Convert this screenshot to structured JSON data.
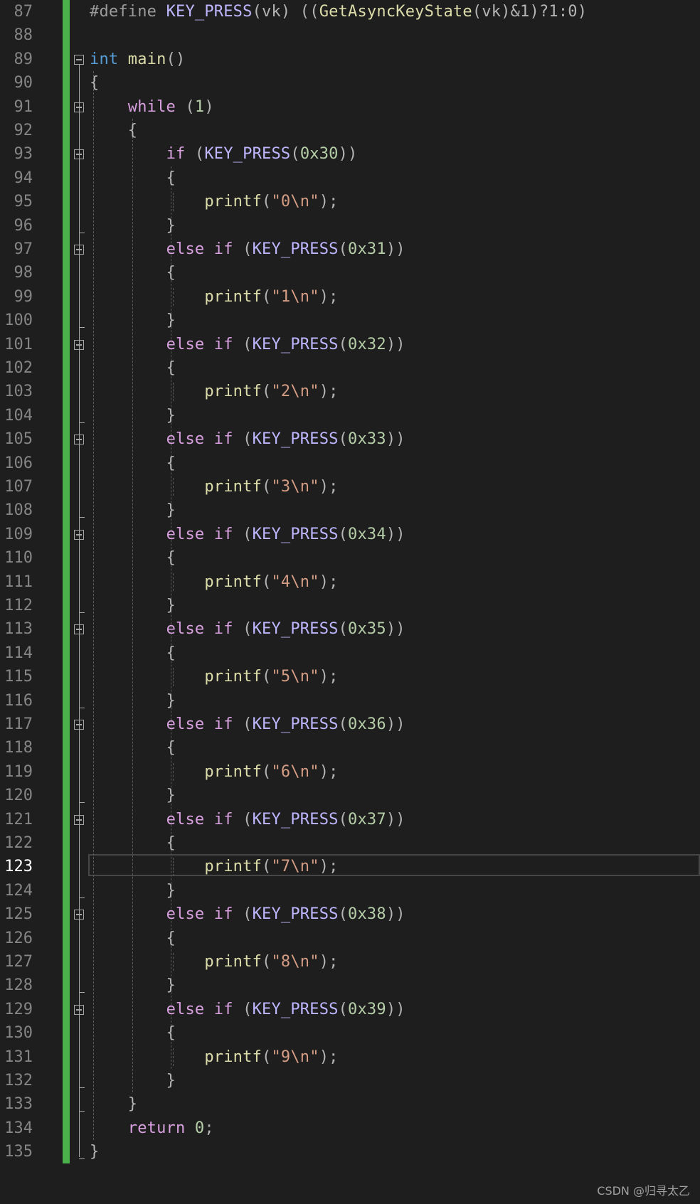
{
  "editor": {
    "current_line_number": "123",
    "lines": [
      {
        "n": "87",
        "tokens": [
          {
            "t": "#define ",
            "c": "pp"
          },
          {
            "t": "KEY_PRESS",
            "c": "mac"
          },
          {
            "t": "(vk) ((",
            "c": "punc"
          },
          {
            "t": "GetAsyncKeyState",
            "c": "fn"
          },
          {
            "t": "(vk)&1)?1:0)",
            "c": "punc"
          }
        ]
      },
      {
        "n": "88",
        "tokens": []
      },
      {
        "n": "89",
        "tokens": [
          {
            "t": "int ",
            "c": "kw"
          },
          {
            "t": "main",
            "c": "fn"
          },
          {
            "t": "()",
            "c": "punc"
          }
        ]
      },
      {
        "n": "90",
        "tokens": [
          {
            "t": "{",
            "c": "punc"
          }
        ]
      },
      {
        "n": "91",
        "tokens": [
          {
            "t": "    "
          },
          {
            "t": "while",
            "c": "ctl"
          },
          {
            "t": " (",
            "c": "punc"
          },
          {
            "t": "1",
            "c": "num"
          },
          {
            "t": ")",
            "c": "punc"
          }
        ]
      },
      {
        "n": "92",
        "tokens": [
          {
            "t": "    {",
            "c": "punc"
          }
        ]
      },
      {
        "n": "93",
        "tokens": [
          {
            "t": "        "
          },
          {
            "t": "if",
            "c": "ctl"
          },
          {
            "t": " (",
            "c": "punc"
          },
          {
            "t": "KEY_PRESS",
            "c": "mac"
          },
          {
            "t": "(",
            "c": "punc"
          },
          {
            "t": "0x30",
            "c": "num"
          },
          {
            "t": "))",
            "c": "punc"
          }
        ]
      },
      {
        "n": "94",
        "tokens": [
          {
            "t": "        {",
            "c": "punc"
          }
        ]
      },
      {
        "n": "95",
        "tokens": [
          {
            "t": "            "
          },
          {
            "t": "printf",
            "c": "fn"
          },
          {
            "t": "(",
            "c": "punc"
          },
          {
            "t": "\"0\\n\"",
            "c": "str"
          },
          {
            "t": ");",
            "c": "punc"
          }
        ]
      },
      {
        "n": "96",
        "tokens": [
          {
            "t": "        }",
            "c": "punc"
          }
        ]
      },
      {
        "n": "97",
        "tokens": [
          {
            "t": "        "
          },
          {
            "t": "else if",
            "c": "ctl"
          },
          {
            "t": " (",
            "c": "punc"
          },
          {
            "t": "KEY_PRESS",
            "c": "mac"
          },
          {
            "t": "(",
            "c": "punc"
          },
          {
            "t": "0x31",
            "c": "num"
          },
          {
            "t": "))",
            "c": "punc"
          }
        ]
      },
      {
        "n": "98",
        "tokens": [
          {
            "t": "        {",
            "c": "punc"
          }
        ]
      },
      {
        "n": "99",
        "tokens": [
          {
            "t": "            "
          },
          {
            "t": "printf",
            "c": "fn"
          },
          {
            "t": "(",
            "c": "punc"
          },
          {
            "t": "\"1\\n\"",
            "c": "str"
          },
          {
            "t": ");",
            "c": "punc"
          }
        ]
      },
      {
        "n": "100",
        "tokens": [
          {
            "t": "        }",
            "c": "punc"
          }
        ]
      },
      {
        "n": "101",
        "tokens": [
          {
            "t": "        "
          },
          {
            "t": "else if",
            "c": "ctl"
          },
          {
            "t": " (",
            "c": "punc"
          },
          {
            "t": "KEY_PRESS",
            "c": "mac"
          },
          {
            "t": "(",
            "c": "punc"
          },
          {
            "t": "0x32",
            "c": "num"
          },
          {
            "t": "))",
            "c": "punc"
          }
        ]
      },
      {
        "n": "102",
        "tokens": [
          {
            "t": "        {",
            "c": "punc"
          }
        ]
      },
      {
        "n": "103",
        "tokens": [
          {
            "t": "            "
          },
          {
            "t": "printf",
            "c": "fn"
          },
          {
            "t": "(",
            "c": "punc"
          },
          {
            "t": "\"2\\n\"",
            "c": "str"
          },
          {
            "t": ");",
            "c": "punc"
          }
        ]
      },
      {
        "n": "104",
        "tokens": [
          {
            "t": "        }",
            "c": "punc"
          }
        ]
      },
      {
        "n": "105",
        "tokens": [
          {
            "t": "        "
          },
          {
            "t": "else if",
            "c": "ctl"
          },
          {
            "t": " (",
            "c": "punc"
          },
          {
            "t": "KEY_PRESS",
            "c": "mac"
          },
          {
            "t": "(",
            "c": "punc"
          },
          {
            "t": "0x33",
            "c": "num"
          },
          {
            "t": "))",
            "c": "punc"
          }
        ]
      },
      {
        "n": "106",
        "tokens": [
          {
            "t": "        {",
            "c": "punc"
          }
        ]
      },
      {
        "n": "107",
        "tokens": [
          {
            "t": "            "
          },
          {
            "t": "printf",
            "c": "fn"
          },
          {
            "t": "(",
            "c": "punc"
          },
          {
            "t": "\"3\\n\"",
            "c": "str"
          },
          {
            "t": ");",
            "c": "punc"
          }
        ]
      },
      {
        "n": "108",
        "tokens": [
          {
            "t": "        }",
            "c": "punc"
          }
        ]
      },
      {
        "n": "109",
        "tokens": [
          {
            "t": "        "
          },
          {
            "t": "else if",
            "c": "ctl"
          },
          {
            "t": " (",
            "c": "punc"
          },
          {
            "t": "KEY_PRESS",
            "c": "mac"
          },
          {
            "t": "(",
            "c": "punc"
          },
          {
            "t": "0x34",
            "c": "num"
          },
          {
            "t": "))",
            "c": "punc"
          }
        ]
      },
      {
        "n": "110",
        "tokens": [
          {
            "t": "        {",
            "c": "punc"
          }
        ]
      },
      {
        "n": "111",
        "tokens": [
          {
            "t": "            "
          },
          {
            "t": "printf",
            "c": "fn"
          },
          {
            "t": "(",
            "c": "punc"
          },
          {
            "t": "\"4\\n\"",
            "c": "str"
          },
          {
            "t": ");",
            "c": "punc"
          }
        ]
      },
      {
        "n": "112",
        "tokens": [
          {
            "t": "        }",
            "c": "punc"
          }
        ]
      },
      {
        "n": "113",
        "tokens": [
          {
            "t": "        "
          },
          {
            "t": "else if",
            "c": "ctl"
          },
          {
            "t": " (",
            "c": "punc"
          },
          {
            "t": "KEY_PRESS",
            "c": "mac"
          },
          {
            "t": "(",
            "c": "punc"
          },
          {
            "t": "0x35",
            "c": "num"
          },
          {
            "t": "))",
            "c": "punc"
          }
        ]
      },
      {
        "n": "114",
        "tokens": [
          {
            "t": "        {",
            "c": "punc"
          }
        ]
      },
      {
        "n": "115",
        "tokens": [
          {
            "t": "            "
          },
          {
            "t": "printf",
            "c": "fn"
          },
          {
            "t": "(",
            "c": "punc"
          },
          {
            "t": "\"5\\n\"",
            "c": "str"
          },
          {
            "t": ");",
            "c": "punc"
          }
        ]
      },
      {
        "n": "116",
        "tokens": [
          {
            "t": "        }",
            "c": "punc"
          }
        ]
      },
      {
        "n": "117",
        "tokens": [
          {
            "t": "        "
          },
          {
            "t": "else if",
            "c": "ctl"
          },
          {
            "t": " (",
            "c": "punc"
          },
          {
            "t": "KEY_PRESS",
            "c": "mac"
          },
          {
            "t": "(",
            "c": "punc"
          },
          {
            "t": "0x36",
            "c": "num"
          },
          {
            "t": "))",
            "c": "punc"
          }
        ]
      },
      {
        "n": "118",
        "tokens": [
          {
            "t": "        {",
            "c": "punc"
          }
        ]
      },
      {
        "n": "119",
        "tokens": [
          {
            "t": "            "
          },
          {
            "t": "printf",
            "c": "fn"
          },
          {
            "t": "(",
            "c": "punc"
          },
          {
            "t": "\"6\\n\"",
            "c": "str"
          },
          {
            "t": ");",
            "c": "punc"
          }
        ]
      },
      {
        "n": "120",
        "tokens": [
          {
            "t": "        }",
            "c": "punc"
          }
        ]
      },
      {
        "n": "121",
        "tokens": [
          {
            "t": "        "
          },
          {
            "t": "else if",
            "c": "ctl"
          },
          {
            "t": " (",
            "c": "punc"
          },
          {
            "t": "KEY_PRESS",
            "c": "mac"
          },
          {
            "t": "(",
            "c": "punc"
          },
          {
            "t": "0x37",
            "c": "num"
          },
          {
            "t": "))",
            "c": "punc"
          }
        ]
      },
      {
        "n": "122",
        "tokens": [
          {
            "t": "        {",
            "c": "punc"
          }
        ]
      },
      {
        "n": "123",
        "tokens": [
          {
            "t": "            "
          },
          {
            "t": "printf",
            "c": "fn"
          },
          {
            "t": "(",
            "c": "punc"
          },
          {
            "t": "\"7\\n\"",
            "c": "str"
          },
          {
            "t": ");",
            "c": "punc"
          }
        ]
      },
      {
        "n": "124",
        "tokens": [
          {
            "t": "        }",
            "c": "punc"
          }
        ]
      },
      {
        "n": "125",
        "tokens": [
          {
            "t": "        "
          },
          {
            "t": "else if",
            "c": "ctl"
          },
          {
            "t": " (",
            "c": "punc"
          },
          {
            "t": "KEY_PRESS",
            "c": "mac"
          },
          {
            "t": "(",
            "c": "punc"
          },
          {
            "t": "0x38",
            "c": "num"
          },
          {
            "t": "))",
            "c": "punc"
          }
        ]
      },
      {
        "n": "126",
        "tokens": [
          {
            "t": "        {",
            "c": "punc"
          }
        ]
      },
      {
        "n": "127",
        "tokens": [
          {
            "t": "            "
          },
          {
            "t": "printf",
            "c": "fn"
          },
          {
            "t": "(",
            "c": "punc"
          },
          {
            "t": "\"8\\n\"",
            "c": "str"
          },
          {
            "t": ");",
            "c": "punc"
          }
        ]
      },
      {
        "n": "128",
        "tokens": [
          {
            "t": "        }",
            "c": "punc"
          }
        ]
      },
      {
        "n": "129",
        "tokens": [
          {
            "t": "        "
          },
          {
            "t": "else if",
            "c": "ctl"
          },
          {
            "t": " (",
            "c": "punc"
          },
          {
            "t": "KEY_PRESS",
            "c": "mac"
          },
          {
            "t": "(",
            "c": "punc"
          },
          {
            "t": "0x39",
            "c": "num"
          },
          {
            "t": "))",
            "c": "punc"
          }
        ]
      },
      {
        "n": "130",
        "tokens": [
          {
            "t": "        {",
            "c": "punc"
          }
        ]
      },
      {
        "n": "131",
        "tokens": [
          {
            "t": "            "
          },
          {
            "t": "printf",
            "c": "fn"
          },
          {
            "t": "(",
            "c": "punc"
          },
          {
            "t": "\"9\\n\"",
            "c": "str"
          },
          {
            "t": ");",
            "c": "punc"
          }
        ]
      },
      {
        "n": "132",
        "tokens": [
          {
            "t": "        }",
            "c": "punc"
          }
        ]
      },
      {
        "n": "133",
        "tokens": [
          {
            "t": "    }",
            "c": "punc"
          }
        ]
      },
      {
        "n": "134",
        "tokens": [
          {
            "t": "    "
          },
          {
            "t": "return",
            "c": "ctl"
          },
          {
            "t": " ",
            "c": "punc"
          },
          {
            "t": "0",
            "c": "num"
          },
          {
            "t": ";",
            "c": "punc"
          }
        ]
      },
      {
        "n": "135",
        "tokens": [
          {
            "t": "}",
            "c": "punc"
          }
        ]
      }
    ]
  },
  "watermark": "CSDN @归寻太乙"
}
